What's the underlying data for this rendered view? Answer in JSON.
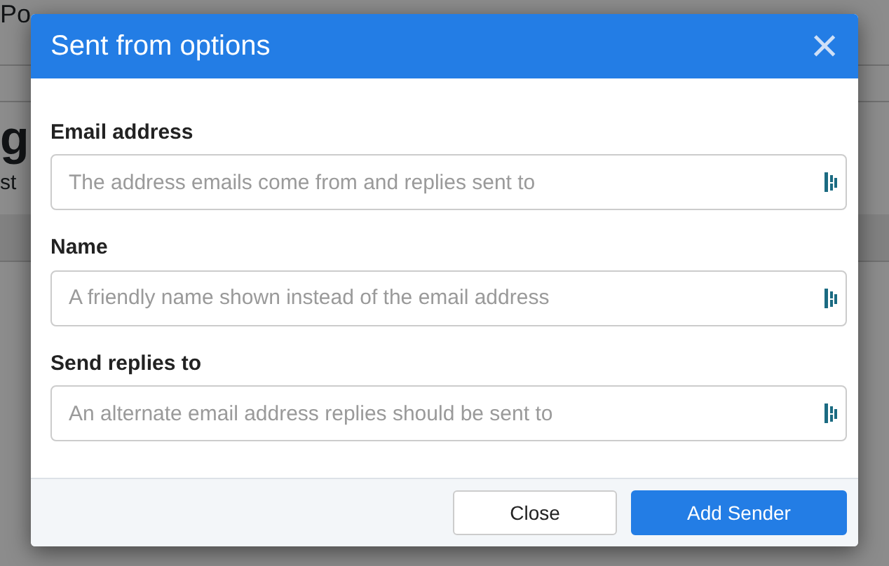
{
  "background": {
    "user_name": "Po",
    "heading": "g",
    "subtitle": "st"
  },
  "modal": {
    "title": "Sent from options",
    "close_symbol": "×",
    "fields": [
      {
        "label": "Email address",
        "placeholder": "The address emails come from and replies sent to"
      },
      {
        "label": "Name",
        "placeholder": "A friendly name shown instead of the email address"
      },
      {
        "label": "Send replies to",
        "placeholder": "An alternate email address replies should be sent to"
      }
    ],
    "buttons": [
      {
        "label": "Close",
        "kind": "secondary"
      },
      {
        "label": "Add Sender",
        "kind": "primary"
      }
    ]
  }
}
